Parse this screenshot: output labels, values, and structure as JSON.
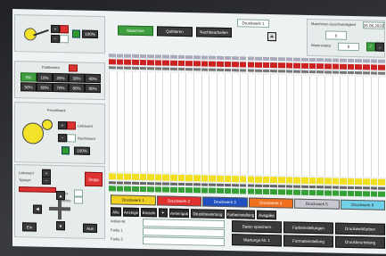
{
  "top_tabs": [
    "Maschine",
    "Quittieren",
    "Nachbearbeiten"
  ],
  "machine_select": "Druckwerk 1",
  "machine_info": {
    "title": "Maschinen-Geschwindigkeit",
    "speed_value": "0",
    "date_value": "26.08.2022",
    "sub_label": "Warenstatus",
    "sub_value": "0"
  },
  "left_panels": {
    "farbkasten_title": "Farbkasten",
    "farbkasten_buttons": [
      "0%",
      "10%",
      "20%",
      "30%",
      "40%",
      "50%",
      "60%",
      "70%",
      "80%",
      "90%"
    ],
    "farbwerk_title": "Feuchtwerk",
    "feucht_labels": [
      "Linkswert",
      "Rechtswert"
    ],
    "zoom_label": "100%"
  },
  "controls": {
    "tool_label": "Stopp",
    "l_labels": [
      "Linkswert",
      "Teilwert",
      "Links",
      "Rechts"
    ],
    "sm_btns": [
      "Ein",
      "Aus"
    ]
  },
  "color_tabs": [
    {
      "label": "Druckwerk 1",
      "color": "#f0d020"
    },
    {
      "label": "Druckwerk 2",
      "color": "#e03030"
    },
    {
      "label": "Druckwerk 3",
      "color": "#2050c0"
    },
    {
      "label": "Druckwerk 4",
      "color": "#f07020"
    },
    {
      "label": "Druckwerk 5",
      "color": "#c8c8d0"
    },
    {
      "label": "Druckwerk 6",
      "color": "#70d0e8"
    }
  ],
  "toolbar_btns": [
    "Alle",
    "Anzeige",
    "Einzeln",
    "▸",
    "Werteingabe",
    "Druckbewertung",
    "Farbeinstellung",
    "Ausgabe"
  ],
  "bottom_labels": [
    "Artikel-Nr.",
    "Farbe 1",
    "Farbe 2"
  ],
  "bottom_btns": [
    "Daten speichern",
    "Farbeinstellungen",
    "Druckwerkfarben",
    "Wartungs-Nr. 1",
    "Formateinstellung",
    "Druckbeurteilung"
  ]
}
